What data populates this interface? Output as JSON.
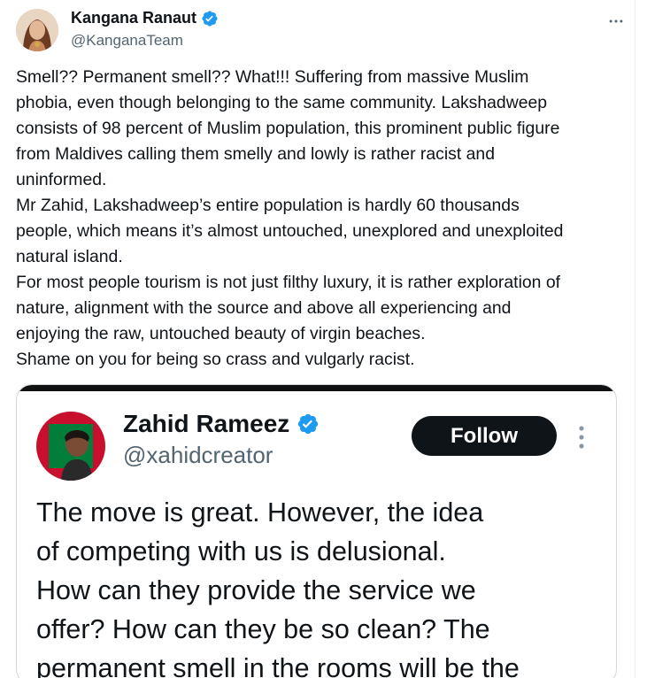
{
  "tweet": {
    "author": {
      "display_name": "Kangana Ranaut",
      "handle": "@KanganaTeam",
      "verified_icon": "verified-badge-icon",
      "avatar_icon": "avatar"
    },
    "more_icon": "more-horizontal-icon",
    "text_lines": [
      "Smell?? Permanent smell?? What!!! Suffering from massive Muslim",
      "phobia, even though belonging to the same community. Lakshadweep",
      "consists of 98 percent of Muslim population, this prominent public figure",
      "from Maldives calling them smelly and lowly is rather racist and",
      "uninformed.",
      "Mr Zahid, Lakshadweep’s entire population is hardly 60 thousands",
      "people, which means it’s almost untouched, unexplored and unexploited",
      "natural island.",
      "For most people tourism is not just filthy luxury, it is rather exploration of",
      "nature, alignment with the source and above all experiencing and",
      "enjoying the raw, untouched beauty of virgin beaches.",
      "Shame on you for being so crass and vulgarly racist."
    ]
  },
  "embedded_screenshot": {
    "author": {
      "display_name": "Zahid Rameez",
      "handle": "@xahidcreator"
    },
    "follow_label": "Follow",
    "text_lines": [
      "The move is great. However, the idea",
      "of competing with us is delusional.",
      "How can they provide the service we",
      "offer? How can they be so clean? The",
      "permanent smell in the rooms will be the"
    ]
  },
  "colors": {
    "text_primary": "#0f1419",
    "text_secondary": "#536471",
    "verified_blue": "#1d9bf0",
    "border": "#cfd9de"
  }
}
